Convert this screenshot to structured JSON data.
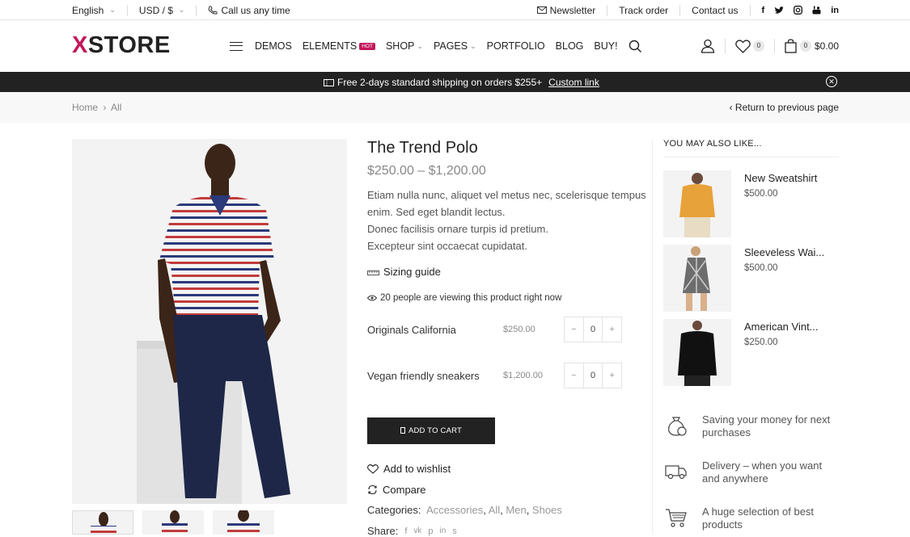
{
  "topbar": {
    "language": "English",
    "currency": "USD / $",
    "call": "Call us any time",
    "newsletter": "Newsletter",
    "track": "Track order",
    "contact": "Contact us",
    "social": [
      "f",
      "t",
      "ig",
      "yt",
      "in"
    ]
  },
  "header": {
    "logo_x": "X",
    "logo_rest": "STORE",
    "nav": [
      "DEMOS",
      "ELEMENTS",
      "SHOP",
      "PAGES",
      "PORTFOLIO",
      "BLOG",
      "BUY!"
    ],
    "hot": "HOT",
    "wishlist_count": "0",
    "cart_count": "0",
    "cart_total": "$0.00"
  },
  "promo": {
    "text": "Free 2-days standard shipping on orders $255+",
    "link": "Custom link"
  },
  "breadcrumb": {
    "home": "Home",
    "current": "All",
    "back": "Return to previous page"
  },
  "product": {
    "title": "The Trend Polo",
    "price": "$250.00 – $1,200.00",
    "desc_lines": [
      "Etiam nulla nunc, aliquet vel metus nec, scelerisque tempus",
      "enim. Sed eget blandit lectus.",
      "Donec facilisis ornare turpis id pretium.",
      "Excepteur sint occaecat cupidatat."
    ],
    "sizing": "Sizing guide",
    "viewing": "20 people are viewing this product right now",
    "group": [
      {
        "name": "Originals California",
        "price": "$250.00",
        "qty": "0"
      },
      {
        "name": "Vegan friendly sneakers",
        "price": "$1,200.00",
        "qty": "0"
      }
    ],
    "add_to_cart": "ADD TO CART",
    "wishlist": "Add to wishlist",
    "compare": "Compare",
    "categories_label": "Categories:",
    "categories": [
      "Accessories",
      "All",
      "Men",
      "Shoes"
    ],
    "share_label": "Share:"
  },
  "sidebar": {
    "title": "YOU MAY ALSO LIKE...",
    "items": [
      {
        "name": "New Sweatshirt",
        "price": "$500.00",
        "color": "#e8a23a"
      },
      {
        "name": "Sleeveless Wai...",
        "price": "$500.00",
        "color": "#555"
      },
      {
        "name": "American Vint...",
        "price": "$250.00",
        "color": "#111"
      }
    ],
    "features": [
      "Saving your money for next purchases",
      "Delivery – when you want and anywhere",
      "A huge selection of best products"
    ]
  },
  "colors": {
    "accent": "#c2185b",
    "dark": "#222222"
  }
}
